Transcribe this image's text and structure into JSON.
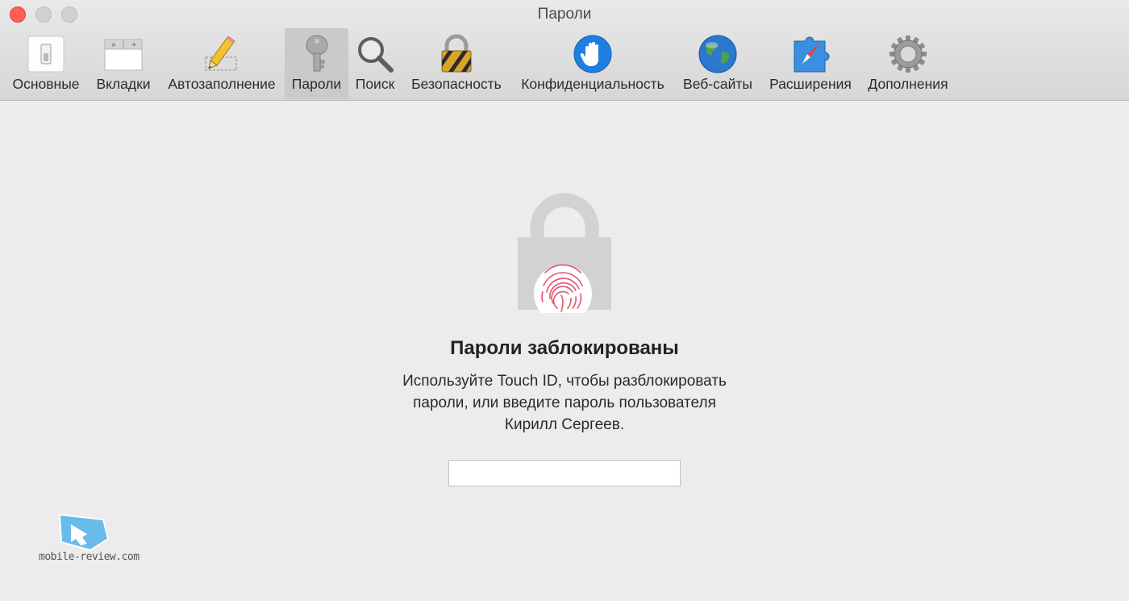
{
  "window": {
    "title": "Пароли"
  },
  "toolbar": {
    "tabs": [
      {
        "label": "Основные",
        "icon": "general-icon"
      },
      {
        "label": "Вкладки",
        "icon": "tabs-icon"
      },
      {
        "label": "Автозаполнение",
        "icon": "pencil-icon"
      },
      {
        "label": "Пароли",
        "icon": "key-icon",
        "selected": true
      },
      {
        "label": "Поиск",
        "icon": "magnifier-icon"
      },
      {
        "label": "Безопасность",
        "icon": "padlock-icon"
      },
      {
        "label": "Конфиденциальность",
        "icon": "hand-icon"
      },
      {
        "label": "Веб-сайты",
        "icon": "globe-icon"
      },
      {
        "label": "Расширения",
        "icon": "extensions-icon"
      },
      {
        "label": "Дополнения",
        "icon": "gear-icon"
      }
    ]
  },
  "main": {
    "lock_icon": "lock-touchid-icon",
    "heading": "Пароли заблокированы",
    "description_lines": [
      "Используйте Touch ID, чтобы разблокировать",
      "пароли, или введите пароль пользователя",
      "Кирилл Сергеев."
    ],
    "password_value": ""
  },
  "watermark": {
    "text": "mobile-review.com"
  },
  "colors": {
    "accent_red": "#fe5f57",
    "fingerprint": "#e0566e",
    "toolbar_selected": "#cacaca"
  }
}
